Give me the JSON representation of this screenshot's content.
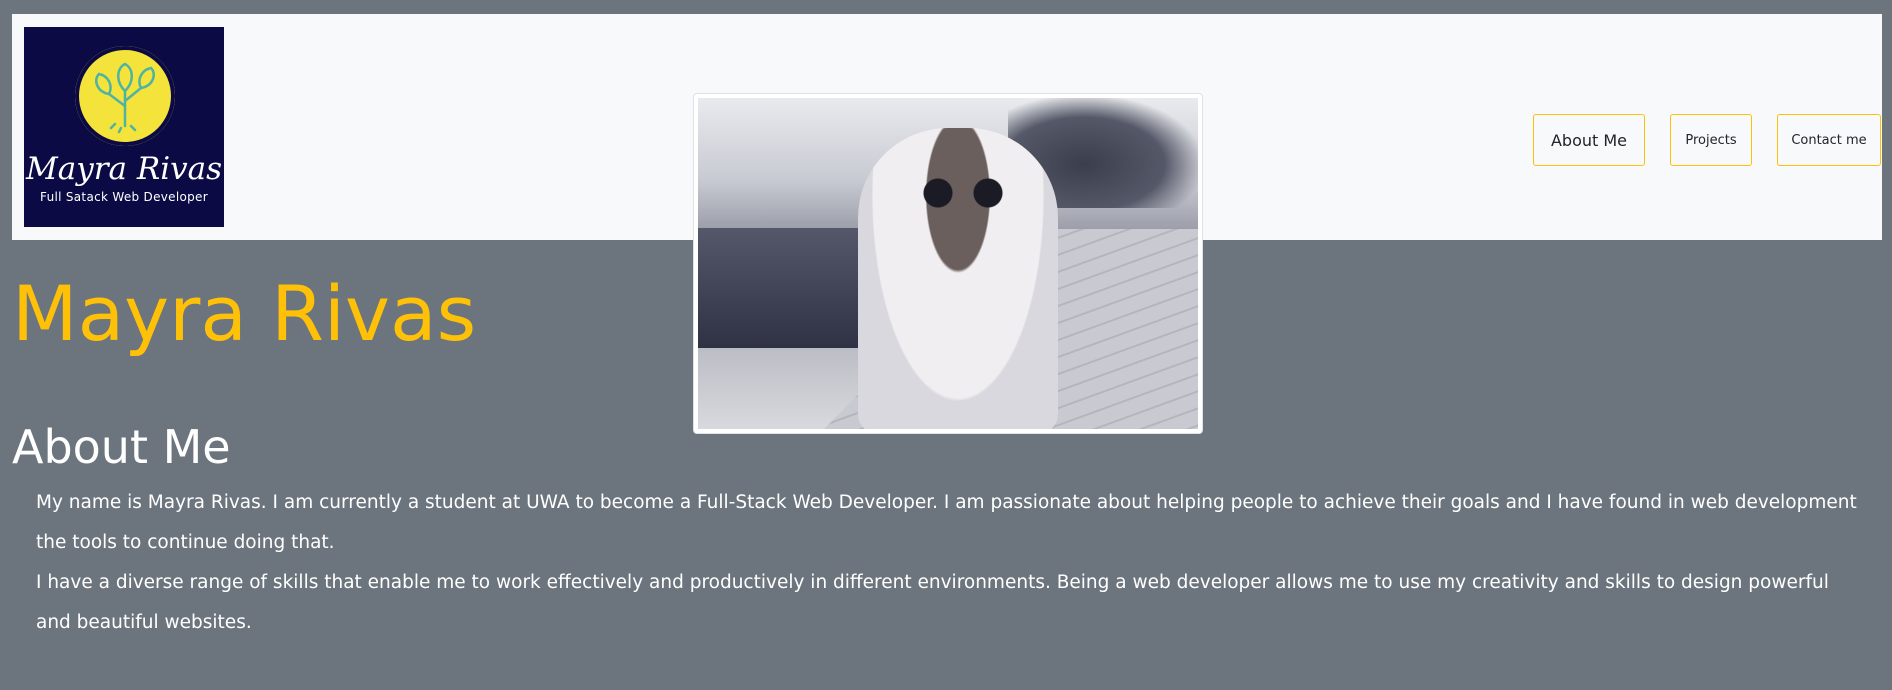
{
  "header": {
    "logo": {
      "name": "Mayra Rivas",
      "tagline": "Full Satack Web Developer",
      "icon": "leaf-sun-icon"
    },
    "nav": {
      "about": "About Me",
      "projects": "Projects",
      "contact": "Contact me"
    }
  },
  "photo": {
    "icon": "profile-photo"
  },
  "hero": {
    "name": "Mayra Rivas"
  },
  "about": {
    "title": "About Me",
    "paragraph1": "My name is Mayra Rivas. I am currently a student at UWA to become a Full-Stack Web Developer. I am passionate about helping people to achieve their goals and I have found in web development the tools to continue doing that.",
    "paragraph2": "I have a diverse range of skills that enable me to work effectively and productively in different environments. Being a web developer allows me to use my creativity and skills to design powerful and beautiful websites."
  },
  "colors": {
    "background": "#6c757d",
    "header": "#f8f9fa",
    "accent": "#ffc107",
    "logo_bg": "#0b0a45",
    "logo_sun": "#f3e33b"
  }
}
